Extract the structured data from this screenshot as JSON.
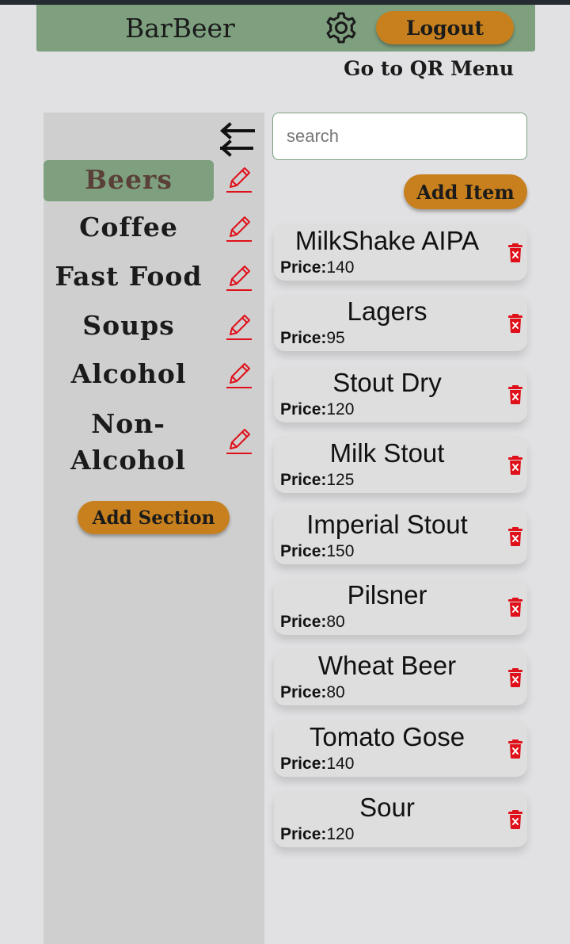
{
  "header": {
    "title": "BarBeer",
    "settings_icon": "gear-icon",
    "logout_label": "Logout",
    "qr_link": "Go to QR Menu"
  },
  "sidebar": {
    "toggle_icon": "swap-arrows-icon",
    "sections": [
      {
        "label": "Beers",
        "active": true
      },
      {
        "label": "Coffee",
        "active": false
      },
      {
        "label": "Fast Food",
        "active": false
      },
      {
        "label": "Soups",
        "active": false
      },
      {
        "label": "Alcohol",
        "active": false
      },
      {
        "label": "Non-Alcohol",
        "active": false
      }
    ],
    "edit_icon": "pencil-icon",
    "add_section_label": "Add Section"
  },
  "main": {
    "search_placeholder": "search",
    "add_item_label": "Add Item",
    "price_label": "Price:",
    "delete_icon": "trash-icon",
    "items": [
      {
        "name": "MilkShake AIPA",
        "price": "140"
      },
      {
        "name": "Lagers",
        "price": "95"
      },
      {
        "name": "Stout Dry",
        "price": "120"
      },
      {
        "name": "Milk Stout",
        "price": "125"
      },
      {
        "name": "Imperial Stout",
        "price": "150"
      },
      {
        "name": "Pilsner",
        "price": "80"
      },
      {
        "name": "Wheat Beer",
        "price": "80"
      },
      {
        "name": "Tomato Gose",
        "price": "140"
      },
      {
        "name": "Sour",
        "price": "120"
      }
    ]
  },
  "colors": {
    "header_bg": "#7ea07f",
    "button_bg": "#c7801d",
    "sidebar_bg": "#cfcfcf",
    "page_bg": "#e1e1e3",
    "delete_red": "#e0101a",
    "edit_red": "#e0101a"
  }
}
